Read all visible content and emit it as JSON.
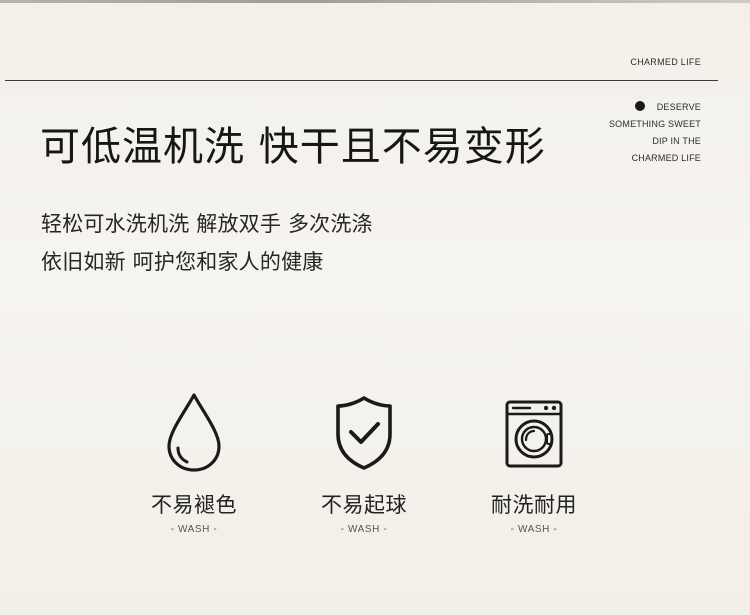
{
  "brand": {
    "name": "CHARMED LIFE",
    "tagline": [
      "DESERVE",
      "SOMETHING SWEET",
      "DIP IN THE",
      "CHARMED LIFE"
    ]
  },
  "headline": "可低温机洗 快干且不易变形",
  "description": [
    "轻松可水洗机洗 解放双手 多次洗涤",
    "依旧如新 呵护您和家人的健康"
  ],
  "features": [
    {
      "icon": "water-drop-icon",
      "title": "不易褪色",
      "sub": "- WASH -"
    },
    {
      "icon": "shield-check-icon",
      "title": "不易起球",
      "sub": "- WASH -"
    },
    {
      "icon": "washing-machine-icon",
      "title": "耐洗耐用",
      "sub": "- WASH -"
    }
  ],
  "colors": {
    "background": "#f4f1eb",
    "text": "#1c1c1c",
    "rule": "#3b3b3b"
  }
}
